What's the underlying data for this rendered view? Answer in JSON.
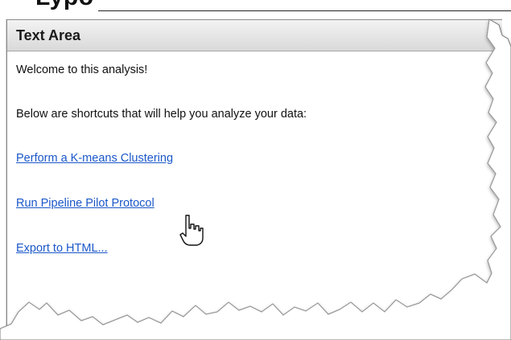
{
  "header_fragment": "Lypo",
  "panel": {
    "title": "Text Area"
  },
  "text": {
    "welcome": "Welcome to this analysis!",
    "intro": "Below are shortcuts that will help you analyze your data:"
  },
  "links": {
    "kmeans": "Perform a K-means Clustering",
    "pipeline": "Run Pipeline Pilot Protocol",
    "export": "Export to HTML..."
  },
  "colors": {
    "link": "#1a57c8",
    "header": "#e3e3e3"
  },
  "icons": {
    "cursor": "hand-pointer-icon"
  }
}
